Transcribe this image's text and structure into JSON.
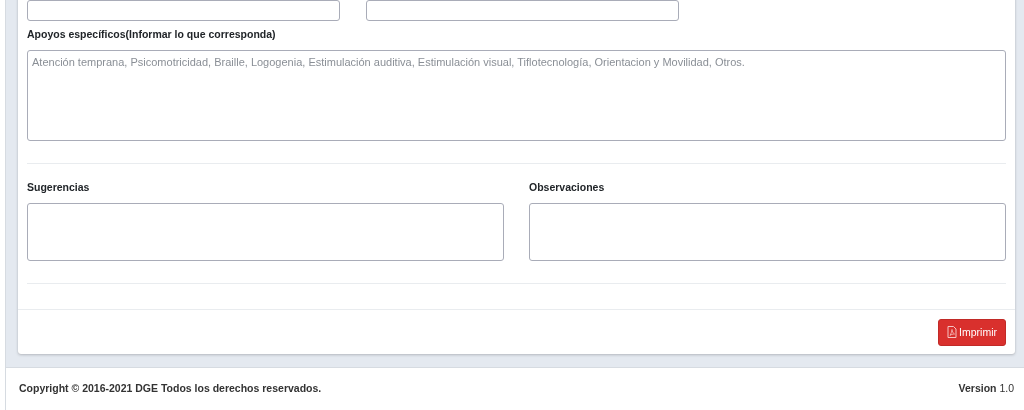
{
  "support_field": {
    "label": "Apoyos específicos(Informar lo que corresponda)",
    "placeholder": "Atención temprana, Psicomotricidad, Braille, Logogenia, Estimulación auditiva, Estimulación visual, Tiflotecnología, Orientacion y Movilidad, Otros."
  },
  "notes_fields": [
    {
      "label": "Sugerencias"
    },
    {
      "label": "Observaciones"
    }
  ],
  "print_button": {
    "label": "Imprimir"
  },
  "footer": {
    "copyright": "Copyright © 2016-2021 DGE Todos los derechos reservados.",
    "version_label": "Version",
    "version_number": "1.0"
  }
}
